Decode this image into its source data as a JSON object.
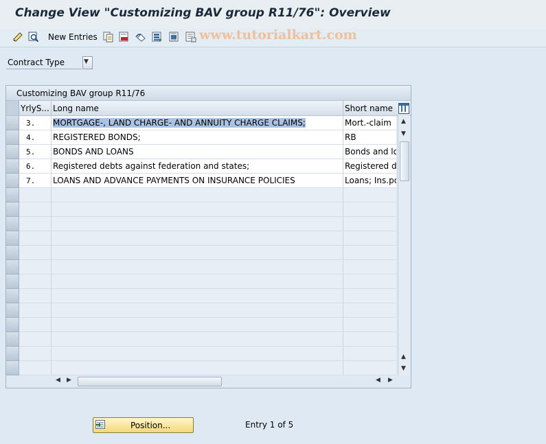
{
  "window": {
    "title": "Change View \"Customizing BAV group R11/76\": Overview"
  },
  "toolbar": {
    "new_entries_label": "New Entries",
    "icons": [
      "edit-display-toggle-icon",
      "find-icon",
      "copy-icon",
      "delete-icon",
      "undo-icon",
      "select-all-icon",
      "select-block-icon",
      "deselect-all-icon"
    ],
    "watermark": "www.tutorialkart.com"
  },
  "filter": {
    "contract_type_label": "Contract Type"
  },
  "table": {
    "title": "Customizing BAV group R11/76",
    "columns": [
      "YrlyS...",
      "Long name",
      "Short name"
    ],
    "rows": [
      {
        "id": "3.",
        "long_name": "MORTGAGE-, LAND CHARGE- AND ANNUITY CHARGE CLAIMS;",
        "short_name": "Mort.-claim"
      },
      {
        "id": "4.",
        "long_name": "REGISTERED BONDS;",
        "short_name": "RB"
      },
      {
        "id": "5.",
        "long_name": "BONDS AND LOANS",
        "short_name": "Bonds and loa"
      },
      {
        "id": "6.",
        "long_name": "Registered debts against federation and states;",
        "short_name": "Registered de"
      },
      {
        "id": "7.",
        "long_name": "LOANS AND ADVANCE PAYMENTS ON INSURANCE POLICIES",
        "short_name": "Loans; Ins.pol"
      }
    ],
    "selected_row": 0
  },
  "footer": {
    "position_button_label": "Position...",
    "entry_info": "Entry 1 of 5"
  },
  "colors": {
    "accent_button": "#f3d97a",
    "selection": "#a8c3e3",
    "background": "#dfe9f3"
  }
}
